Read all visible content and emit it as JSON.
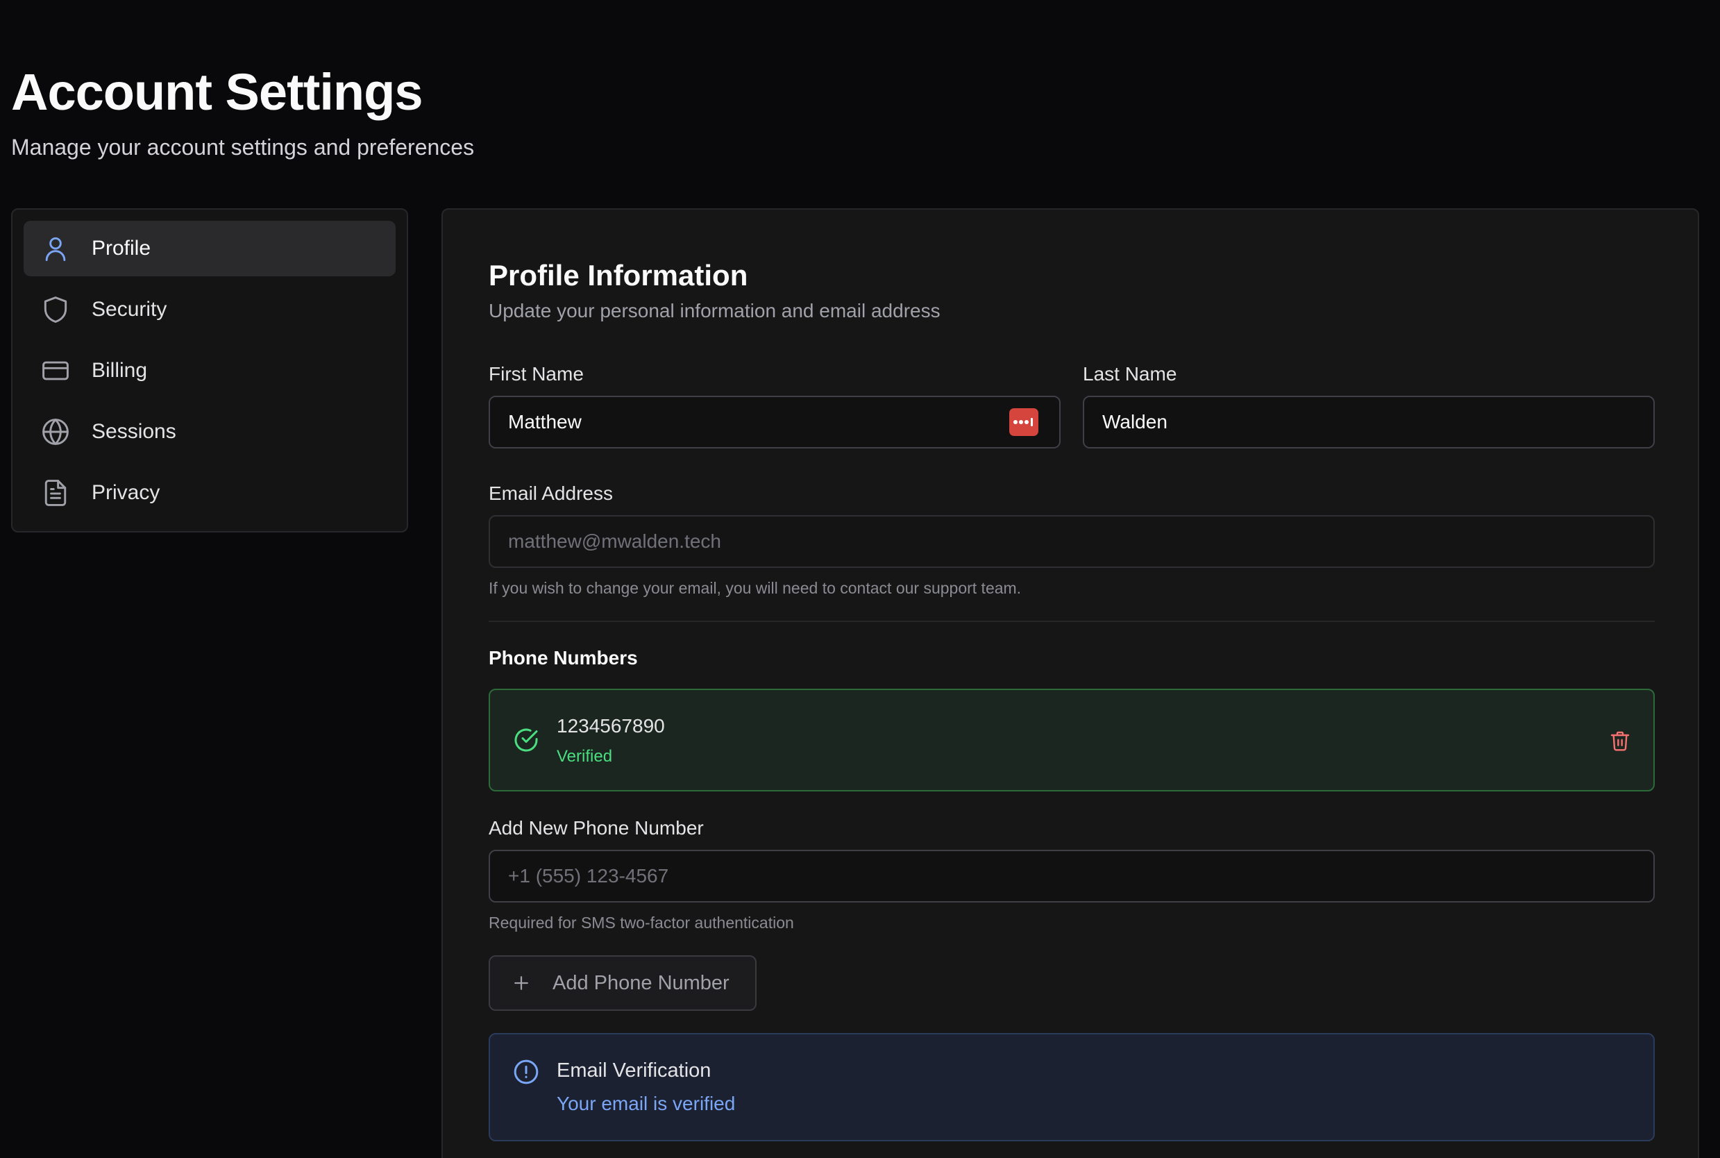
{
  "header": {
    "title": "Account Settings",
    "subtitle": "Manage your account settings and preferences"
  },
  "sidebar": {
    "items": [
      {
        "label": "Profile",
        "icon": "user-icon",
        "active": true
      },
      {
        "label": "Security",
        "icon": "shield-icon",
        "active": false
      },
      {
        "label": "Billing",
        "icon": "credit-card-icon",
        "active": false
      },
      {
        "label": "Sessions",
        "icon": "globe-icon",
        "active": false
      },
      {
        "label": "Privacy",
        "icon": "document-icon",
        "active": false
      }
    ]
  },
  "profile": {
    "title": "Profile Information",
    "description": "Update your personal information and email address",
    "first_name_label": "First Name",
    "first_name_value": "Matthew",
    "last_name_label": "Last Name",
    "last_name_value": "Walden",
    "email_label": "Email Address",
    "email_placeholder": "matthew@mwalden.tech",
    "email_hint": "If you wish to change your email, you will need to contact our support team."
  },
  "phones": {
    "heading": "Phone Numbers",
    "items": [
      {
        "number": "1234567890",
        "status": "Verified"
      }
    ],
    "add_label": "Add New Phone Number",
    "add_placeholder": "+1 (555) 123-4567",
    "add_hint": "Required for SMS two-factor authentication",
    "add_button": "Add Phone Number"
  },
  "email_verification": {
    "title": "Email Verification",
    "message": "Your email is verified"
  },
  "colors": {
    "accent_blue": "#7aa6f5",
    "success_green": "#4ade80",
    "danger_red": "#f87171",
    "password_manager_red": "#d6453d"
  }
}
